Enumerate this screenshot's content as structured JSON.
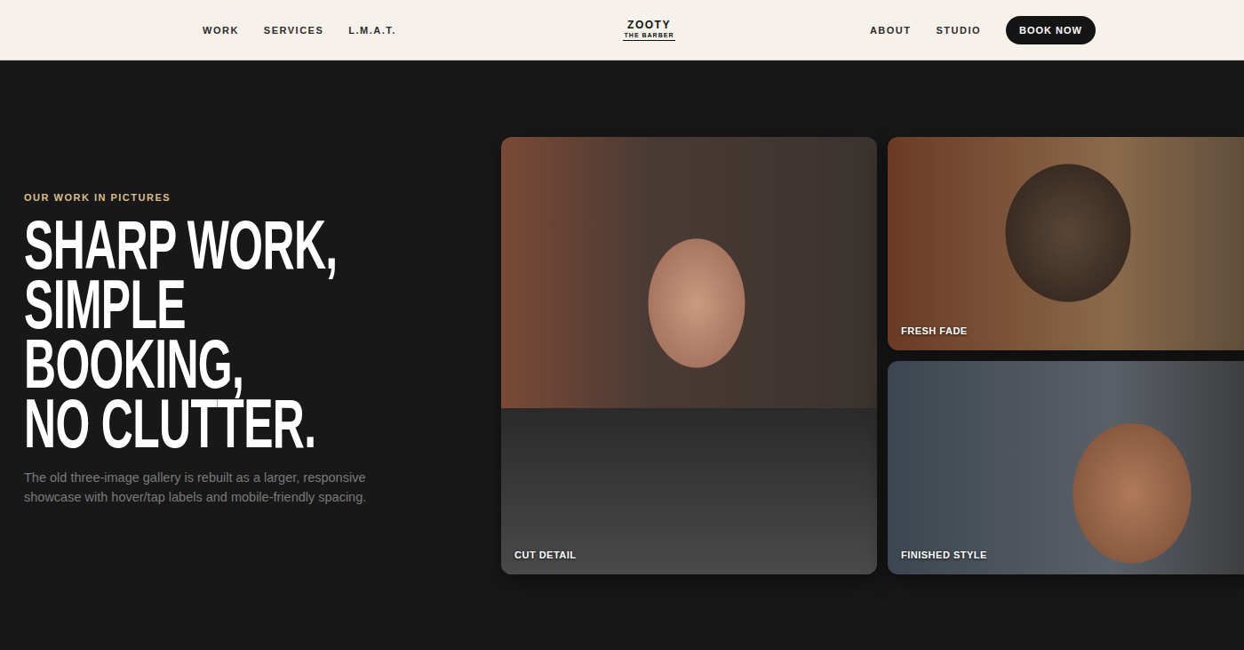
{
  "nav": {
    "left": [
      "WORK",
      "SERVICES",
      "L.M.A.T."
    ],
    "logo": {
      "name": "ZOOTY",
      "tagline": "THE BARBER"
    },
    "right": [
      "ABOUT",
      "STUDIO"
    ],
    "cta": "BOOK NOW"
  },
  "hero": {
    "eyebrow": "OUR WORK IN PICTURES",
    "headline": [
      "SHARP WORK,",
      "SIMPLE",
      "BOOKING,",
      "NO CLUTTER."
    ],
    "description": "The old three-image gallery is rebuilt as a larger, responsive showcase with hover/tap labels and mobile-friendly spacing."
  },
  "gallery": [
    {
      "label": "CUT DETAIL"
    },
    {
      "label": "FRESH FADE"
    },
    {
      "label": "FINISHED STYLE"
    }
  ]
}
